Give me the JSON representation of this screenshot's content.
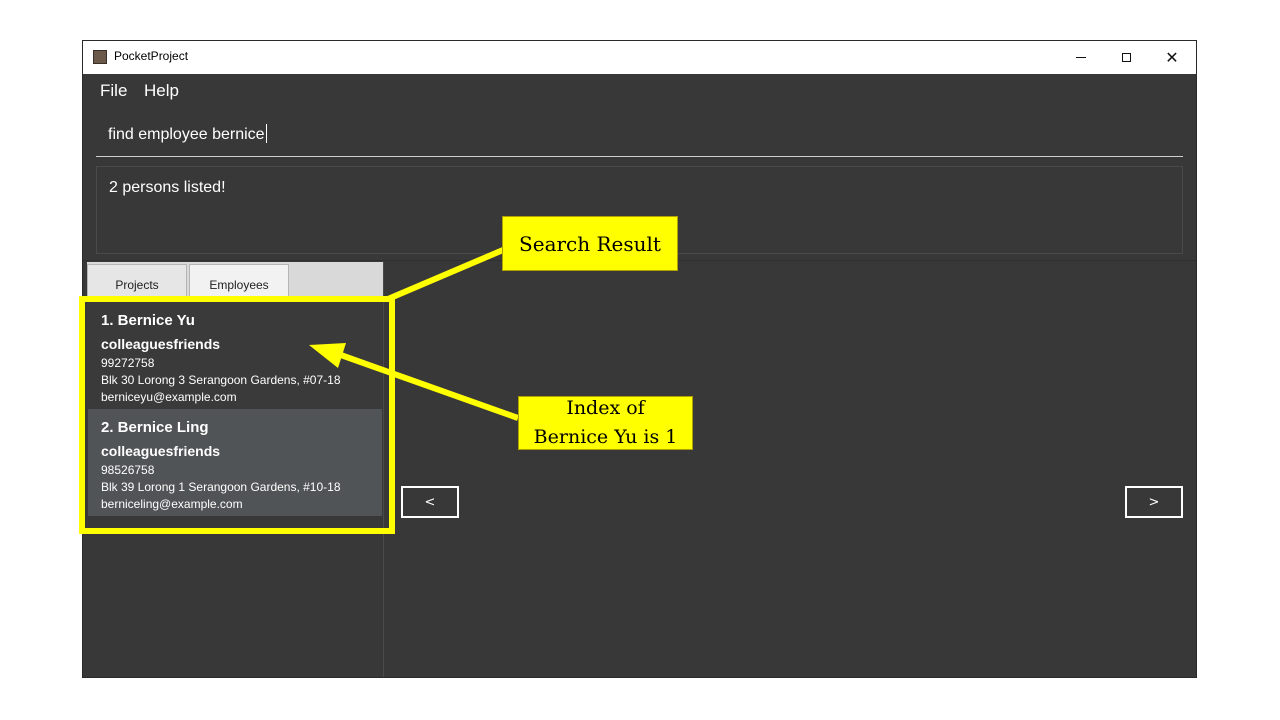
{
  "window": {
    "title": "PocketProject",
    "controls": {
      "minimize": "minimize",
      "maximize": "maximize",
      "close": "✕"
    }
  },
  "menu": {
    "file": "File",
    "help": "Help"
  },
  "command": {
    "value": "find employee bernice"
  },
  "result": {
    "message": "2 persons listed!"
  },
  "tabs": {
    "projects": "Projects",
    "employees": "Employees"
  },
  "employees": [
    {
      "name": "1.  Bernice Yu",
      "tags": "colleaguesfriends",
      "phone": "99272758",
      "address": "Blk 30 Lorong 3 Serangoon Gardens, #07-18",
      "email": "berniceyu@example.com"
    },
    {
      "name": "2.  Bernice Ling",
      "tags": "colleaguesfriends",
      "phone": "98526758",
      "address": "Blk 39 Lorong 1 Serangoon Gardens, #10-18",
      "email": "berniceling@example.com"
    }
  ],
  "nav": {
    "prev": "<",
    "next": ">"
  },
  "annotations": {
    "search_result": "Search Result",
    "index_line1": "Index of",
    "index_line2": "Bernice Yu is 1",
    "highlight_color": "#ffff00"
  }
}
